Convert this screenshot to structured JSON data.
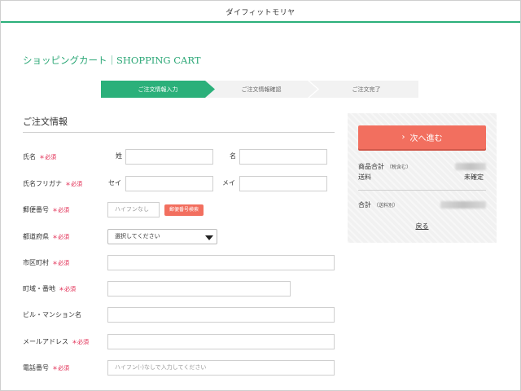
{
  "header": {
    "store_name": "ダイフィットモリヤ"
  },
  "page": {
    "title": "ショッピングカート｜SHOPPING CART"
  },
  "steps": [
    {
      "label": "ご注文情報入力",
      "active": true
    },
    {
      "label": "ご注文情報確認",
      "active": false
    },
    {
      "label": "ご注文完了",
      "active": false
    }
  ],
  "section": {
    "title": "ご注文情報"
  },
  "required_mark": "＊必須",
  "form": {
    "name": {
      "label": "氏名",
      "last_label": "姓",
      "first_label": "名",
      "last_value": "",
      "first_value": ""
    },
    "kana": {
      "label": "氏名フリガナ",
      "last_label": "セイ",
      "first_label": "メイ",
      "last_value": "",
      "first_value": ""
    },
    "zip": {
      "label": "郵便番号",
      "placeholder": "ハイフンなし",
      "button": "郵便番号検索"
    },
    "prefecture": {
      "label": "都道府県",
      "selected": "選択してください"
    },
    "city": {
      "label": "市区町村",
      "value": ""
    },
    "street": {
      "label": "町域・番地",
      "value": ""
    },
    "building": {
      "label": "ビル・マンション名",
      "value": ""
    },
    "email": {
      "label": "メールアドレス",
      "value": ""
    },
    "phone": {
      "label": "電話番号",
      "placeholder": "ハイフン(-)なしで入力してください"
    }
  },
  "summary": {
    "next_button": "次へ進む",
    "next_icon": "chevron-right-icon",
    "subtotal_label": "商品合計",
    "subtotal_note": "（税含む）",
    "shipping_label": "送料",
    "shipping_value": "未確定",
    "total_label": "合計",
    "total_note": "（送料別）",
    "back_link": "戻る"
  },
  "colors": {
    "brand_green": "#2bb07a",
    "accent_coral": "#f26f5f",
    "required_red": "#e0224b"
  }
}
